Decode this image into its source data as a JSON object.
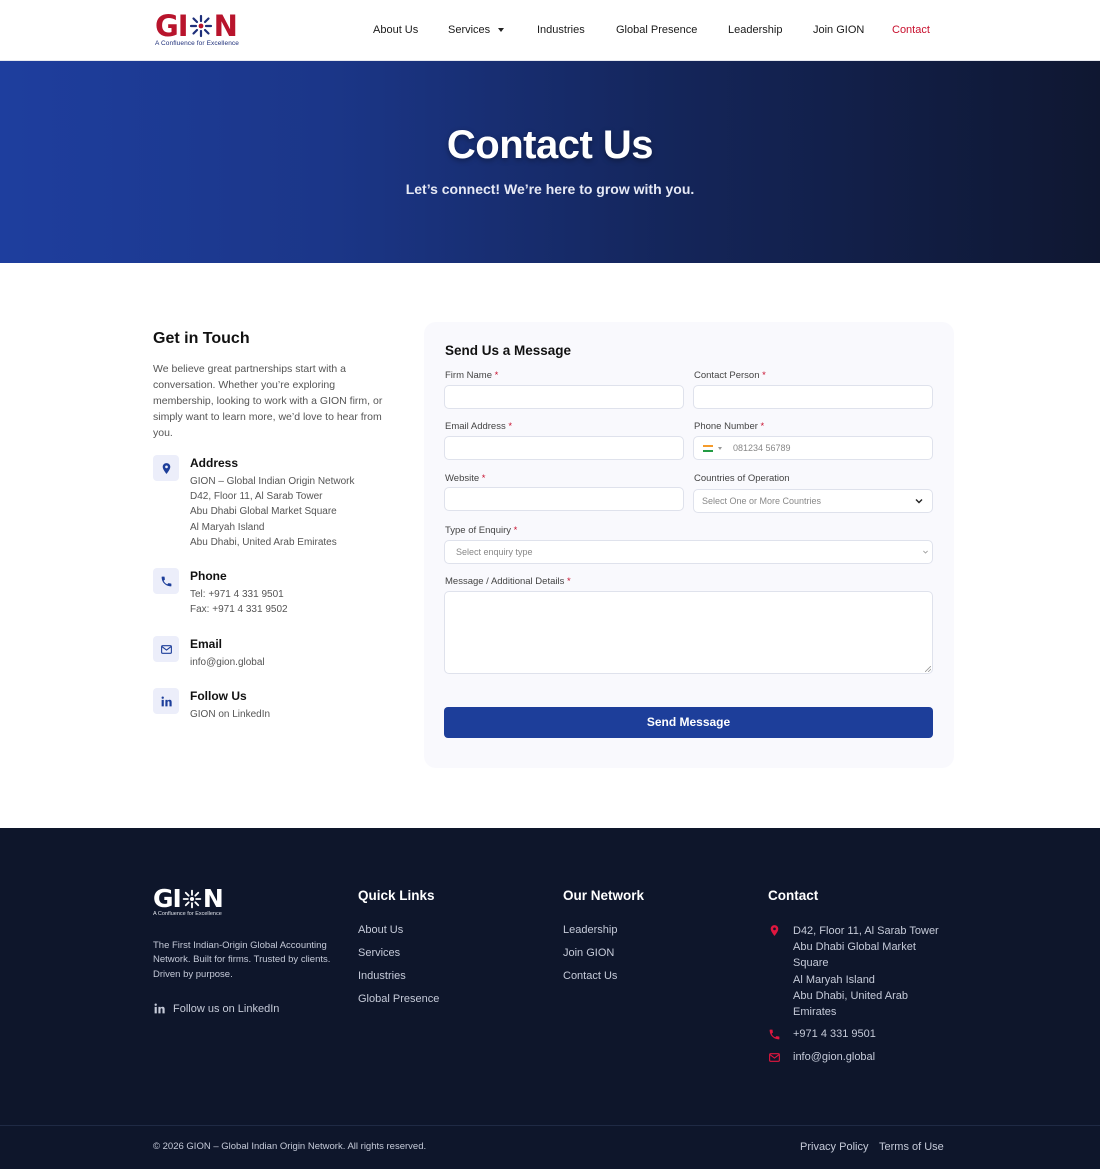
{
  "brand": {
    "logo_pre": "GI",
    "logo_post": "N",
    "tagline": "A Confluence for Excellence",
    "primary_color": "#1d3e9a",
    "accent_color": "#c8102e"
  },
  "nav": {
    "items": [
      {
        "label": "About Us"
      },
      {
        "label": "Services",
        "dropdown": true
      },
      {
        "label": "Industries"
      },
      {
        "label": "Global Presence"
      },
      {
        "label": "Leadership"
      },
      {
        "label": "Join GION"
      },
      {
        "label": "Contact",
        "active": true
      }
    ]
  },
  "hero": {
    "title": "Contact Us",
    "subtitle": "Let’s connect! We’re here to grow with you."
  },
  "get_in_touch": {
    "heading": "Get in Touch",
    "intro": "We believe great partnerships start with a conversation. Whether you’re exploring membership, looking to work with a GION firm, or simply want to learn more, we’d love to hear from you.",
    "address": {
      "icon": "map-pin-icon",
      "title": "Address",
      "lines": [
        "GION – Global Indian Origin Network",
        "D42, Floor 11, Al Sarab Tower",
        "Abu Dhabi Global Market Square",
        "Al Maryah Island",
        "Abu Dhabi, United Arab Emirates"
      ]
    },
    "phone": {
      "icon": "phone-icon",
      "title": "Phone",
      "lines": [
        "Tel: +971 4 331 9501",
        "Fax: +971 4 331 9502"
      ]
    },
    "email": {
      "icon": "envelope-icon",
      "title": "Email",
      "lines": [
        "info@gion.global"
      ]
    },
    "follow": {
      "icon": "linkedin-icon",
      "title": "Follow Us",
      "lines": [
        "GION on LinkedIn"
      ]
    }
  },
  "form": {
    "heading": "Send Us a Message",
    "firm_name": {
      "label": "Firm Name",
      "required": "*",
      "value": ""
    },
    "contact_person": {
      "label": "Contact Person",
      "required": "*",
      "value": ""
    },
    "email": {
      "label": "Email Address",
      "required": "*",
      "value": ""
    },
    "phone": {
      "label": "Phone Number",
      "required": "*",
      "placeholder": "081234 56789",
      "country": "IN"
    },
    "website": {
      "label": "Website",
      "required": "*",
      "value": ""
    },
    "countries": {
      "label": "Countries of Operation",
      "placeholder": "Select One or More Countries"
    },
    "enquiry": {
      "label": "Type of Enquiry",
      "required": "*",
      "placeholder": "Select enquiry type"
    },
    "message": {
      "label": "Message / Additional Details",
      "required": "*",
      "value": ""
    },
    "submit": "Send Message"
  },
  "footer": {
    "description": "The First Indian-Origin Global Accounting Network. Built for firms. Trusted by clients. Driven by purpose.",
    "follow": "Follow us on LinkedIn",
    "quick_links": {
      "heading": "Quick Links",
      "items": [
        "About Us",
        "Services",
        "Industries",
        "Global Presence"
      ]
    },
    "network": {
      "heading": "Our Network",
      "items": [
        "Leadership",
        "Join GION",
        "Contact Us"
      ]
    },
    "contact": {
      "heading": "Contact",
      "address_lines": [
        "D42, Floor 11, Al Sarab Tower",
        "Abu Dhabi Global Market",
        "Square",
        "Al Maryah Island",
        "Abu Dhabi, United Arab",
        "Emirates"
      ],
      "phone": "+971 4 331 9501",
      "email": "info@gion.global"
    },
    "copyright": "© 2026 GION – Global Indian Origin Network. All rights reserved.",
    "privacy": "Privacy Policy",
    "terms": "Terms of Use"
  }
}
